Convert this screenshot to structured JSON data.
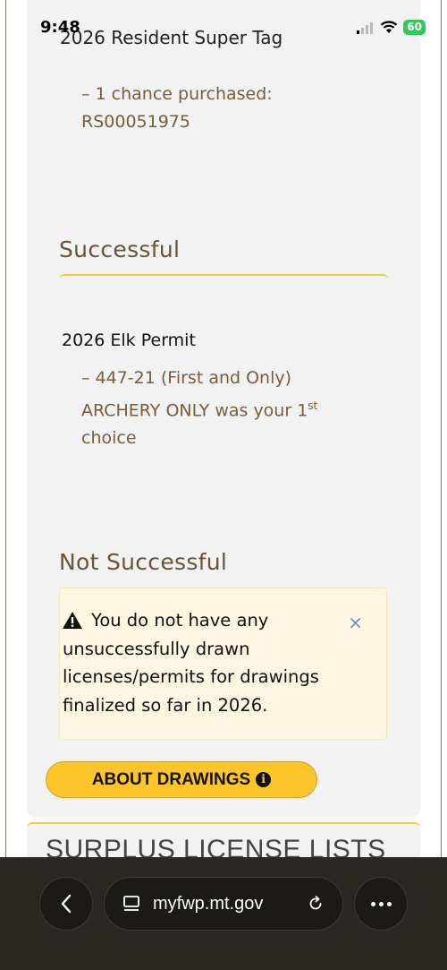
{
  "status_bar": {
    "time": "9:48",
    "battery": "60"
  },
  "super_tag": {
    "title": "2026 Resident Super Tag",
    "chance_line1": "– 1 chance purchased:",
    "chance_line2": "RS00051975"
  },
  "successful": {
    "heading": "Successful",
    "permit_title": "2026 Elk Permit",
    "detail_prefix": "– 447-21 (First and Only) ARCHERY ONLY was your 1",
    "detail_sup": "st",
    "detail_suffix": " choice"
  },
  "not_successful": {
    "heading": "Not Successful",
    "alert_message": "You do not have any unsuccessfully drawn licenses/permits for drawings finalized so far in 2026.",
    "close_symbol": "×"
  },
  "about_button": {
    "label": "ABOUT DRAWINGS",
    "icon_glyph": "i"
  },
  "next_section": {
    "title": "SURPLUS LICENSE LISTS"
  },
  "browser": {
    "url": "myfwp.mt.gov"
  },
  "colors": {
    "accent_yellow": "#fdc52a",
    "heading_brown": "#6b5335",
    "link_brown": "#7a5c38"
  }
}
